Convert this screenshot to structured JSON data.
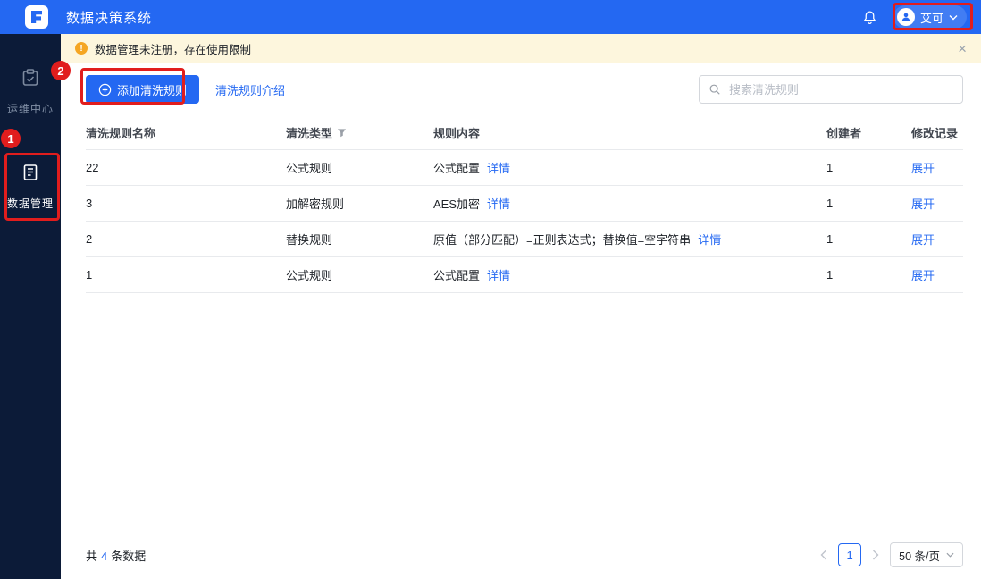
{
  "header": {
    "title": "数据决策系统",
    "user_name": "艾可"
  },
  "sidebar": {
    "items": [
      {
        "label": "运维中心",
        "icon": "ops-clipboard-icon",
        "active": false
      },
      {
        "label": "数据管理",
        "icon": "data-book-icon",
        "active": true
      }
    ]
  },
  "banner": {
    "text": "数据管理未注册，存在使用限制",
    "close_glyph": "×"
  },
  "toolbar": {
    "add_button_label": "添加清洗规则",
    "intro_link_label": "清洗规则介绍",
    "search_placeholder": "搜索清洗规则"
  },
  "table": {
    "headers": {
      "name": "清洗规则名称",
      "type": "清洗类型",
      "content": "规则内容",
      "creator": "创建者",
      "record": "修改记录"
    },
    "rows": [
      {
        "name": "22",
        "type": "公式规则",
        "content": "公式配置",
        "detail_link": "详情",
        "creator": "1",
        "record_link": "展开"
      },
      {
        "name": "3",
        "type": "加解密规则",
        "content": "AES加密",
        "detail_link": "详情",
        "creator": "1",
        "record_link": "展开"
      },
      {
        "name": "2",
        "type": "替换规则",
        "content": "原值（部分匹配）=正则表达式；替换值=空字符串",
        "detail_link": "详情",
        "creator": "1",
        "record_link": "展开"
      },
      {
        "name": "1",
        "type": "公式规则",
        "content": "公式配置",
        "detail_link": "详情",
        "creator": "1",
        "record_link": "展开"
      }
    ]
  },
  "pagination": {
    "total_prefix": "共",
    "total_count": "4",
    "total_suffix": "条数据",
    "page": "1",
    "page_size": "50 条/页"
  },
  "annotations": {
    "step1": "1",
    "step2": "2"
  },
  "colors": {
    "primary": "#2468f2",
    "sidebar_bg": "#0c1b38",
    "banner_bg": "#fdf6dd",
    "annotation_red": "#e11d1d",
    "warning_orange": "#f5a623"
  }
}
